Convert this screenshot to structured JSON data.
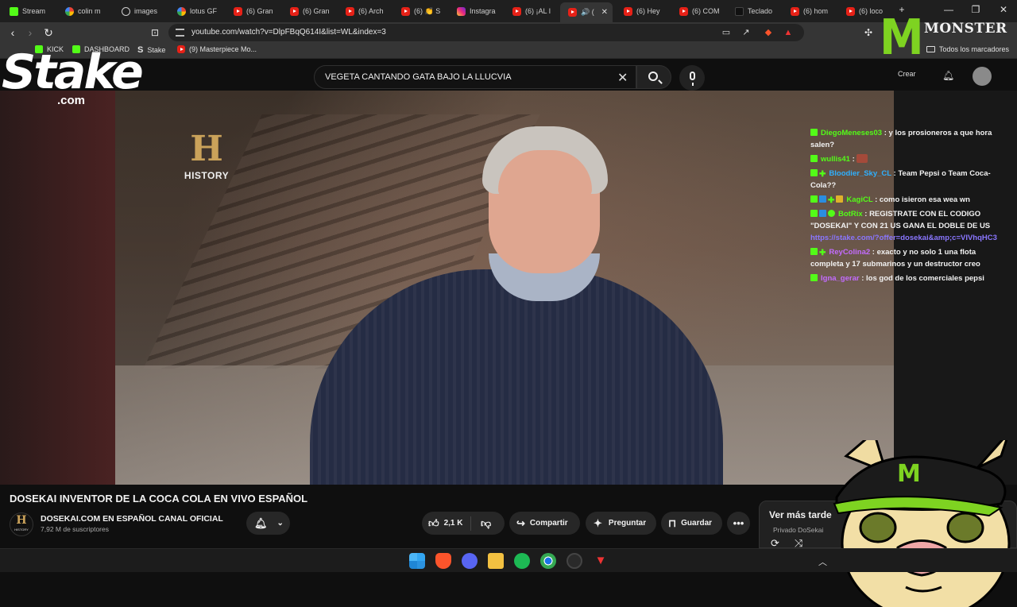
{
  "browser": {
    "tabs": [
      {
        "label": "Stream",
        "icon": "kick-icon"
      },
      {
        "label": "colin m",
        "icon": "google-icon"
      },
      {
        "label": "images",
        "icon": "globe-icon"
      },
      {
        "label": "lotus GF",
        "icon": "google-icon"
      },
      {
        "label": "(6) Gran",
        "icon": "youtube-icon"
      },
      {
        "label": "(6) Gran",
        "icon": "youtube-icon"
      },
      {
        "label": "(6) Arch",
        "icon": "youtube-icon"
      },
      {
        "label": "(6) 👏 S",
        "icon": "youtube-icon"
      },
      {
        "label": "Instagra",
        "icon": "instagram-icon"
      },
      {
        "label": "(6) ¡AL I",
        "icon": "youtube-icon"
      },
      {
        "label": "🔊 (",
        "icon": "youtube-icon",
        "active": true
      },
      {
        "label": "(6) Hey",
        "icon": "youtube-icon"
      },
      {
        "label": "(6) COM",
        "icon": "youtube-icon"
      },
      {
        "label": "Teclado",
        "icon": "app-icon"
      },
      {
        "label": "(6) hom",
        "icon": "youtube-icon"
      },
      {
        "label": "(6) loco",
        "icon": "youtube-icon"
      }
    ],
    "new_tab": "+",
    "url": "youtube.com/watch?v=DlpFBqQ614I&list=WL&index=3",
    "bookmarks": [
      {
        "label": "KICK",
        "icon": "kick-icon"
      },
      {
        "label": "DASHBOARD",
        "icon": "kick-icon"
      },
      {
        "label": "Stake",
        "icon": "stake-icon"
      },
      {
        "label": "(9) Masterpiece Mo...",
        "icon": "youtube-icon"
      }
    ],
    "all_bookmarks": "Todos los marcadores"
  },
  "youtube": {
    "search_query": "VEGETA CANTANDO GATA BAJO LA LLUCVIA",
    "masthead_create": "Crear",
    "video_title": "DOSEKAI INVENTOR DE LA COCA COLA EN VIVO ESPAÑOL",
    "channel_name": "DOSEKAI.COM EN ESPAÑOL CANAL OFICIAL",
    "subscribers": "7,92 M de suscriptores",
    "likes": "2,1 K",
    "share_label": "Compartir",
    "ask_label": "Preguntar",
    "save_label": "Guardar",
    "playlist_title": "Ver más tarde",
    "playlist_sub": "Privado DoSekai",
    "history_logo_text": "HISTORY",
    "history_avatar_text": "HISTORY"
  },
  "overlay": {
    "stake_word": "Stake",
    "stake_com": ".com",
    "monster_word": "MONSTER",
    "chat": [
      {
        "user": "DiegoMeneses03",
        "user_color": "#53fc18",
        "text": ": y los prosioneros a que hora salen?"
      },
      {
        "user": "wullis41",
        "user_color": "#53fc18",
        "text": ":"
      },
      {
        "user": "Bloodier_Sky_CL",
        "user_color": "#2fb0ff",
        "text": ": Team Pepsi o Team Coca-Cola??"
      },
      {
        "user": "KagiCL",
        "user_color": "#53fc18",
        "text": ": como isieron esa wea wn"
      },
      {
        "user": "BotRix",
        "user_color": "#53fc18",
        "text": ": REGISTRATE CON EL CODIGO \"DOSEKAI\" Y CON 21 US GANA EL DOBLE DE US",
        "link": "https://stake.com/?offer=dosekai&amp;c=VIVhqHC3"
      },
      {
        "user": "ReyColina2",
        "user_color": "#c36bff",
        "text": ": exacto y no solo 1 una flota completa y 17 submarinos y un destructor creo"
      },
      {
        "user": "Igna_gerar",
        "user_color": "#c36bff",
        "text": ": los god de los comerciales pepsi"
      }
    ]
  },
  "colors": {
    "accent_green": "#53fc18",
    "youtube_red": "#ff0000",
    "history_gold": "#caa25a"
  }
}
